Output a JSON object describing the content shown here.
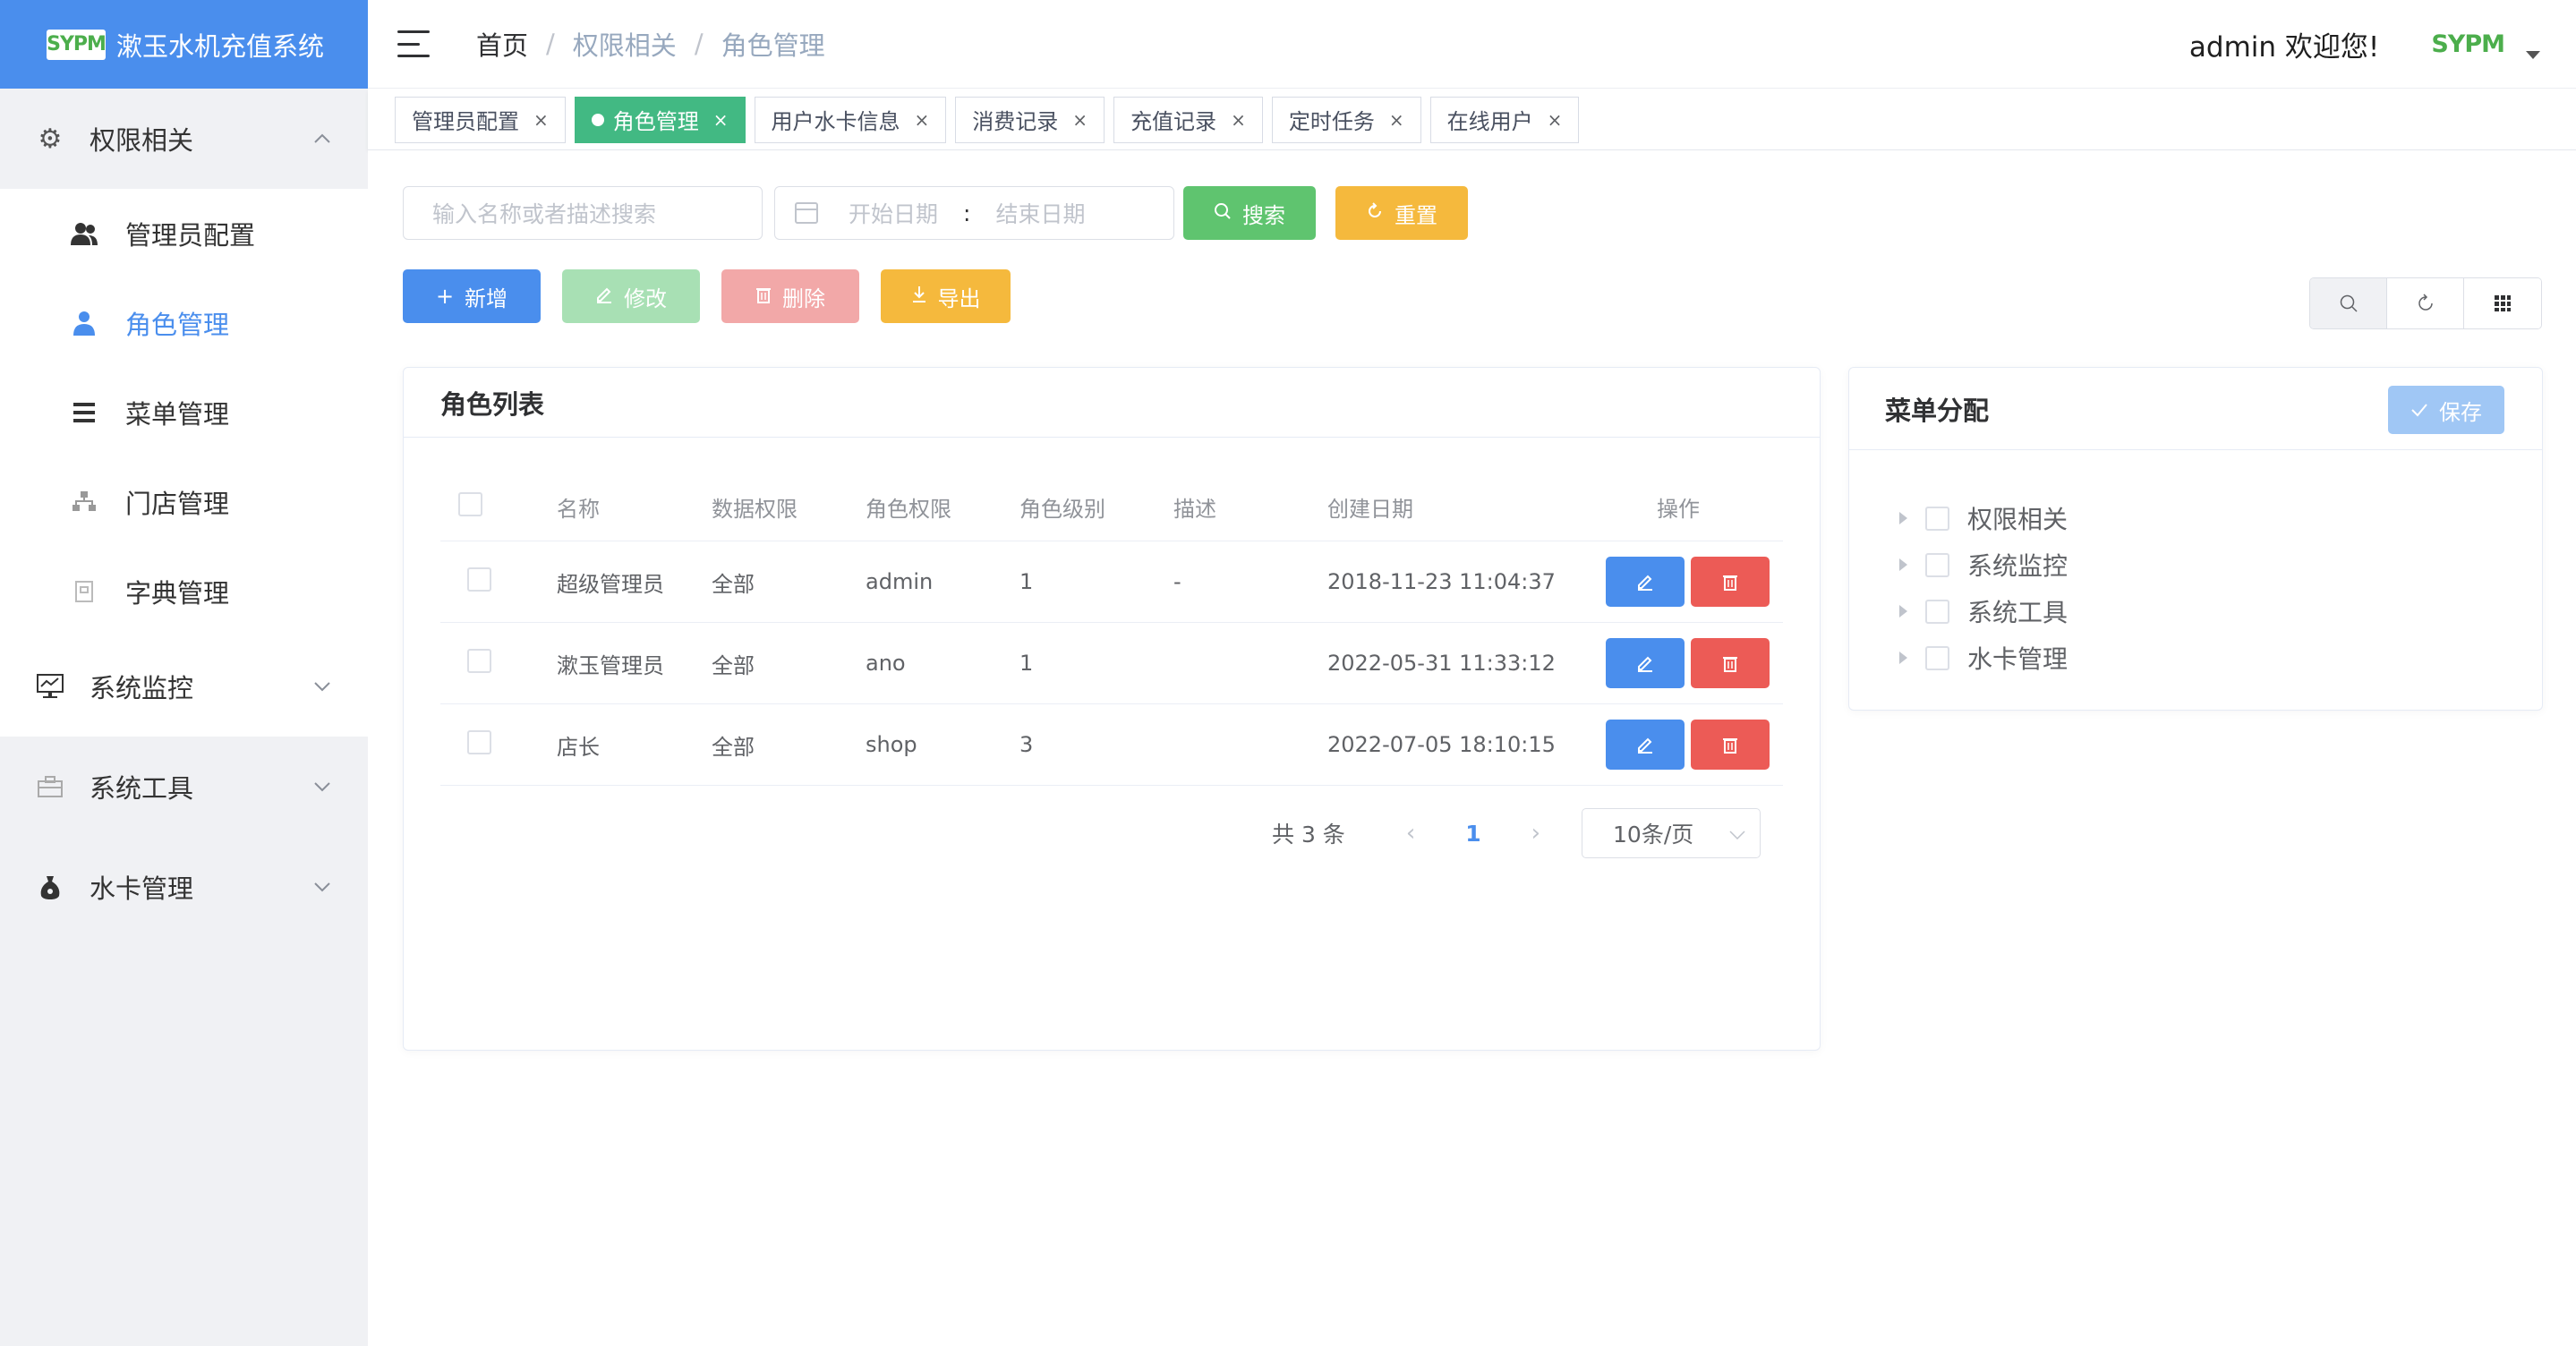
{
  "app": {
    "logo_badge": "SYPM",
    "title": "漱玉水机充值系统"
  },
  "sidebar": {
    "groups": [
      {
        "label": "权限相关",
        "icon": "gear-icon",
        "expanded": true
      },
      {
        "label": "系统监控",
        "icon": "monitor-icon",
        "expanded": false
      },
      {
        "label": "系统工具",
        "icon": "toolbox-icon",
        "expanded": false
      },
      {
        "label": "水卡管理",
        "icon": "money-bag-icon",
        "expanded": false
      }
    ],
    "sub_items": [
      {
        "label": "管理员配置",
        "icon": "users-icon"
      },
      {
        "label": "角色管理",
        "icon": "role-icon",
        "active": true
      },
      {
        "label": "菜单管理",
        "icon": "menu-icon"
      },
      {
        "label": "门店管理",
        "icon": "store-icon"
      },
      {
        "label": "字典管理",
        "icon": "dictionary-icon"
      }
    ]
  },
  "header": {
    "breadcrumb": [
      "首页",
      "权限相关",
      "角色管理"
    ],
    "welcome": "admin 欢迎您!",
    "user_badge": "SYPM"
  },
  "tags": [
    {
      "label": "管理员配置",
      "active": false
    },
    {
      "label": "角色管理",
      "active": true
    },
    {
      "label": "用户水卡信息",
      "active": false
    },
    {
      "label": "消费记录",
      "active": false
    },
    {
      "label": "充值记录",
      "active": false
    },
    {
      "label": "定时任务",
      "active": false
    },
    {
      "label": "在线用户",
      "active": false
    }
  ],
  "search": {
    "keyword_placeholder": "输入名称或者描述搜索",
    "start_date_placeholder": "开始日期",
    "range_separator": ":",
    "end_date_placeholder": "结束日期",
    "search_label": "搜索",
    "reset_label": "重置"
  },
  "actions": {
    "add_label": "新增",
    "edit_label": "修改",
    "delete_label": "删除",
    "export_label": "导出"
  },
  "roles_card": {
    "title": "角色列表",
    "columns": [
      "名称",
      "数据权限",
      "角色权限",
      "角色级别",
      "描述",
      "创建日期",
      "操作"
    ],
    "rows": [
      {
        "name": "超级管理员",
        "scope": "全部",
        "permission": "admin",
        "level": "1",
        "description": "-",
        "created": "2018-11-23 11:04:37"
      },
      {
        "name": "漱玉管理员",
        "scope": "全部",
        "permission": "ano",
        "level": "1",
        "description": "",
        "created": "2022-05-31 11:33:12"
      },
      {
        "name": "店长",
        "scope": "全部",
        "permission": "shop",
        "level": "3",
        "description": "",
        "created": "2022-07-05 18:10:15"
      }
    ],
    "pagination": {
      "total": "共 3 条",
      "current_page": "1",
      "page_size": "10条/页"
    }
  },
  "menu_card": {
    "title": "菜单分配",
    "save_label": "保存",
    "tree": [
      "权限相关",
      "系统监控",
      "系统工具",
      "水卡管理"
    ]
  },
  "colors": {
    "primary": "#4a8eed",
    "success": "#5fc46f",
    "warning": "#f5b93d",
    "danger": "#ec5b56",
    "active_tag": "#42b983"
  }
}
